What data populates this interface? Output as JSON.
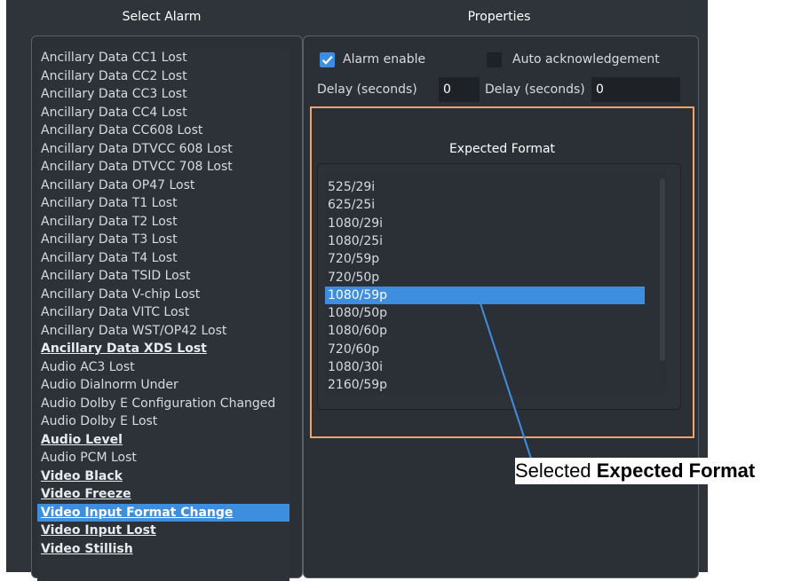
{
  "headers": {
    "select_alarm": "Select Alarm",
    "properties": "Properties"
  },
  "alarms": [
    {
      "label": "Ancillary Data CC1 Lost",
      "bold": false,
      "selected": false
    },
    {
      "label": "Ancillary Data CC2 Lost",
      "bold": false,
      "selected": false
    },
    {
      "label": "Ancillary Data CC3 Lost",
      "bold": false,
      "selected": false
    },
    {
      "label": "Ancillary Data CC4 Lost",
      "bold": false,
      "selected": false
    },
    {
      "label": "Ancillary Data CC608 Lost",
      "bold": false,
      "selected": false
    },
    {
      "label": "Ancillary Data DTVCC 608 Lost",
      "bold": false,
      "selected": false
    },
    {
      "label": "Ancillary Data DTVCC 708 Lost",
      "bold": false,
      "selected": false
    },
    {
      "label": "Ancillary Data OP47 Lost",
      "bold": false,
      "selected": false
    },
    {
      "label": "Ancillary Data T1 Lost",
      "bold": false,
      "selected": false
    },
    {
      "label": "Ancillary Data T2 Lost",
      "bold": false,
      "selected": false
    },
    {
      "label": "Ancillary Data T3 Lost",
      "bold": false,
      "selected": false
    },
    {
      "label": "Ancillary Data T4 Lost",
      "bold": false,
      "selected": false
    },
    {
      "label": "Ancillary Data TSID Lost",
      "bold": false,
      "selected": false
    },
    {
      "label": "Ancillary Data V-chip Lost",
      "bold": false,
      "selected": false
    },
    {
      "label": "Ancillary Data VITC Lost",
      "bold": false,
      "selected": false
    },
    {
      "label": "Ancillary Data WST/OP42 Lost",
      "bold": false,
      "selected": false
    },
    {
      "label": "Ancillary Data XDS Lost",
      "bold": true,
      "selected": false
    },
    {
      "label": "Audio AC3 Lost",
      "bold": false,
      "selected": false
    },
    {
      "label": "Audio Dialnorm Under",
      "bold": false,
      "selected": false
    },
    {
      "label": "Audio Dolby E Configuration Changed",
      "bold": false,
      "selected": false
    },
    {
      "label": "Audio Dolby E Lost",
      "bold": false,
      "selected": false
    },
    {
      "label": "Audio Level",
      "bold": true,
      "selected": false
    },
    {
      "label": "Audio PCM Lost",
      "bold": false,
      "selected": false
    },
    {
      "label": "Video Black",
      "bold": true,
      "selected": false
    },
    {
      "label": "Video Freeze",
      "bold": true,
      "selected": false
    },
    {
      "label": "Video Input Format Change",
      "bold": true,
      "selected": true
    },
    {
      "label": "Video Input Lost",
      "bold": true,
      "selected": false
    },
    {
      "label": "Video Stillish",
      "bold": true,
      "selected": false
    }
  ],
  "properties": {
    "alarm_enable_label": "Alarm enable",
    "alarm_enable_checked": true,
    "auto_ack_label": "Auto acknowledgement",
    "auto_ack_checked": false,
    "delay1_label": "Delay (seconds)",
    "delay1_value": "0",
    "delay2_label": "Delay (seconds)",
    "delay2_value": "0",
    "expected_format_label": "Expected Format",
    "formats": [
      {
        "label": "525/29i",
        "selected": false
      },
      {
        "label": "625/25i",
        "selected": false
      },
      {
        "label": "1080/29i",
        "selected": false
      },
      {
        "label": "1080/25i",
        "selected": false
      },
      {
        "label": "720/59p",
        "selected": false
      },
      {
        "label": "720/50p",
        "selected": false
      },
      {
        "label": "1080/59p",
        "selected": true
      },
      {
        "label": "1080/50p",
        "selected": false
      },
      {
        "label": "1080/60p",
        "selected": false
      },
      {
        "label": "720/60p",
        "selected": false
      },
      {
        "label": "1080/30i",
        "selected": false
      },
      {
        "label": "2160/59p",
        "selected": false
      }
    ]
  },
  "callout": {
    "prefix": "Selected ",
    "bold": "Expected Format"
  },
  "colors": {
    "accent": "#3e8ee0",
    "highlight_box": "#f2a36b",
    "background": "#2f343a"
  }
}
